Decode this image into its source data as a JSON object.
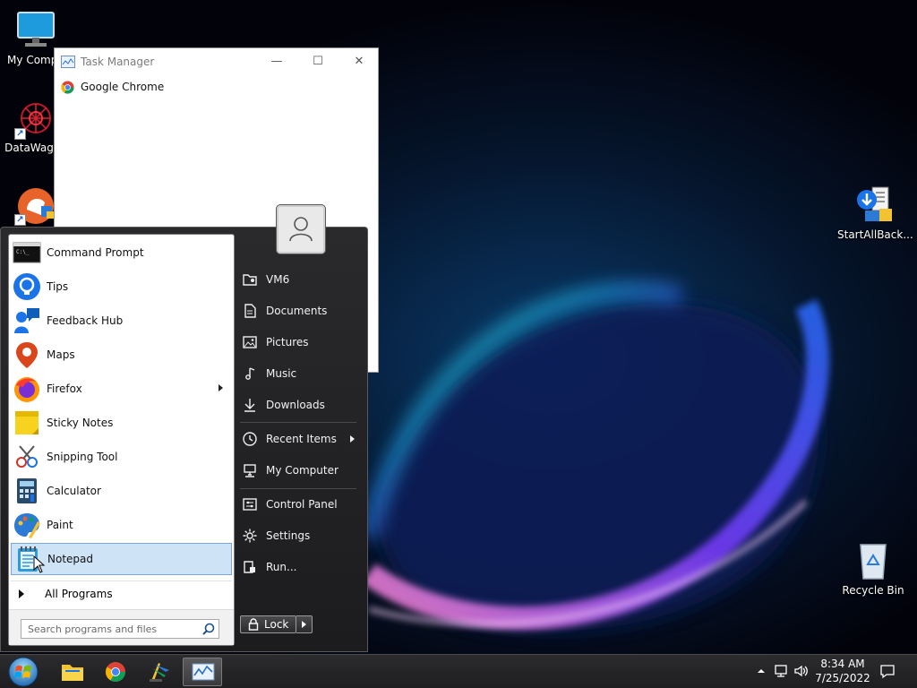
{
  "desktop": {
    "icons": [
      {
        "label": "My Compu",
        "icon": "monitor-icon"
      },
      {
        "label": "DataWagon",
        "icon": "datawagon-icon"
      },
      {
        "label": "",
        "icon": "app-shortcut-icon"
      },
      {
        "label": "StartAllBack...",
        "icon": "startallback-icon"
      },
      {
        "label": "Recycle Bin",
        "icon": "recycle-bin-icon"
      }
    ]
  },
  "task_manager": {
    "title": "Task Manager",
    "processes": [
      {
        "name": "Google Chrome",
        "icon": "chrome-icon"
      }
    ]
  },
  "start_menu": {
    "programs": [
      {
        "label": "Command Prompt",
        "icon": "command-prompt-icon"
      },
      {
        "label": "Tips",
        "icon": "tips-icon"
      },
      {
        "label": "Feedback Hub",
        "icon": "feedback-hub-icon"
      },
      {
        "label": "Maps",
        "icon": "maps-icon"
      },
      {
        "label": "Firefox",
        "icon": "firefox-icon",
        "submenu": true
      },
      {
        "label": "Sticky Notes",
        "icon": "sticky-notes-icon"
      },
      {
        "label": "Snipping Tool",
        "icon": "snipping-tool-icon"
      },
      {
        "label": "Calculator",
        "icon": "calculator-icon"
      },
      {
        "label": "Paint",
        "icon": "paint-icon"
      },
      {
        "label": "Notepad",
        "icon": "notepad-icon",
        "highlighted": true
      }
    ],
    "all_programs": "All Programs",
    "search": {
      "placeholder": "Search programs and files"
    },
    "right_items": [
      {
        "label": "VM6",
        "icon": "user-folder-icon"
      },
      {
        "label": "Documents",
        "icon": "document-icon"
      },
      {
        "label": "Pictures",
        "icon": "picture-icon"
      },
      {
        "label": "Music",
        "icon": "music-icon"
      },
      {
        "label": "Downloads",
        "icon": "download-icon"
      },
      {
        "label": "Recent Items",
        "icon": "clock-icon",
        "submenu": true
      },
      {
        "label": "My Computer",
        "icon": "computer-icon"
      },
      {
        "label": "Control Panel",
        "icon": "control-panel-icon"
      },
      {
        "label": "Settings",
        "icon": "gear-icon"
      },
      {
        "label": "Run...",
        "icon": "run-icon"
      }
    ],
    "lock_label": "Lock"
  },
  "taskbar": {
    "pinned": [
      {
        "name": "File Explorer",
        "icon": "folder-icon"
      },
      {
        "name": "Google Chrome",
        "icon": "chrome-icon"
      },
      {
        "name": "App",
        "icon": "app-icon"
      },
      {
        "name": "Task Manager",
        "icon": "task-manager-icon",
        "active": true
      }
    ],
    "clock": {
      "time": "8:34 AM",
      "date": "7/25/2022"
    }
  },
  "colors": {
    "highlight": "#cfe3f7",
    "startmenu_bg": "#242426",
    "accent": "#1a73e8"
  }
}
